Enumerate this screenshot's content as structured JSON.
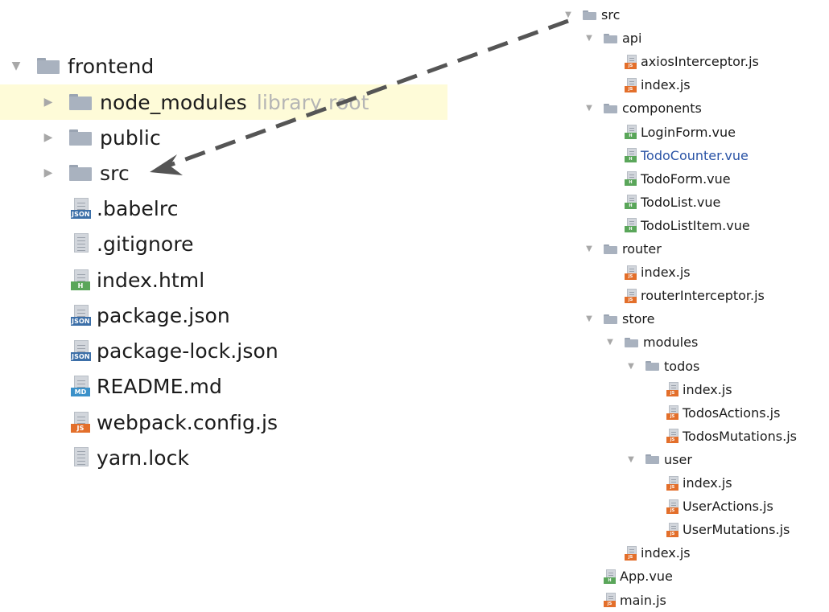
{
  "left_tree": {
    "root": {
      "label": "frontend",
      "expanded": true
    },
    "items": [
      {
        "kind": "folder",
        "label": "node_modules",
        "hint": "library root",
        "expanded": false,
        "highlighted": true
      },
      {
        "kind": "folder",
        "label": "public",
        "expanded": false
      },
      {
        "kind": "folder",
        "label": "src",
        "expanded": false
      },
      {
        "kind": "file",
        "label": ".babelrc",
        "icon": "json-file-icon",
        "tag": "JSON"
      },
      {
        "kind": "file",
        "label": ".gitignore",
        "icon": "text-file-icon",
        "tag": ""
      },
      {
        "kind": "file",
        "label": "index.html",
        "icon": "html-file-icon",
        "tag": "H"
      },
      {
        "kind": "file",
        "label": "package.json",
        "icon": "json-file-icon",
        "tag": "JSON"
      },
      {
        "kind": "file",
        "label": "package-lock.json",
        "icon": "json-file-icon",
        "tag": "JSON"
      },
      {
        "kind": "file",
        "label": "README.md",
        "icon": "markdown-file-icon",
        "tag": "MD"
      },
      {
        "kind": "file",
        "label": "webpack.config.js",
        "icon": "js-file-icon",
        "tag": "JS"
      },
      {
        "kind": "file",
        "label": "yarn.lock",
        "icon": "text-file-icon",
        "tag": ""
      }
    ]
  },
  "right_tree": {
    "items": [
      {
        "depth": 0,
        "kind": "folder",
        "label": "src",
        "expanded": true
      },
      {
        "depth": 1,
        "kind": "folder",
        "label": "api",
        "expanded": true
      },
      {
        "depth": 2,
        "kind": "file",
        "label": "axiosInterceptor.js",
        "tag": "JS"
      },
      {
        "depth": 2,
        "kind": "file",
        "label": "index.js",
        "tag": "JS"
      },
      {
        "depth": 1,
        "kind": "folder",
        "label": "components",
        "expanded": true
      },
      {
        "depth": 2,
        "kind": "file",
        "label": "LoginForm.vue",
        "tag": "H"
      },
      {
        "depth": 2,
        "kind": "file",
        "label": "TodoCounter.vue",
        "tag": "H",
        "modified": true
      },
      {
        "depth": 2,
        "kind": "file",
        "label": "TodoForm.vue",
        "tag": "H"
      },
      {
        "depth": 2,
        "kind": "file",
        "label": "TodoList.vue",
        "tag": "H"
      },
      {
        "depth": 2,
        "kind": "file",
        "label": "TodoListItem.vue",
        "tag": "H"
      },
      {
        "depth": 1,
        "kind": "folder",
        "label": "router",
        "expanded": true
      },
      {
        "depth": 2,
        "kind": "file",
        "label": "index.js",
        "tag": "JS"
      },
      {
        "depth": 2,
        "kind": "file",
        "label": "routerInterceptor.js",
        "tag": "JS"
      },
      {
        "depth": 1,
        "kind": "folder",
        "label": "store",
        "expanded": true
      },
      {
        "depth": 2,
        "kind": "folder",
        "label": "modules",
        "expanded": true
      },
      {
        "depth": 3,
        "kind": "folder",
        "label": "todos",
        "expanded": true
      },
      {
        "depth": 4,
        "kind": "file",
        "label": "index.js",
        "tag": "JS"
      },
      {
        "depth": 4,
        "kind": "file",
        "label": "TodosActions.js",
        "tag": "JS"
      },
      {
        "depth": 4,
        "kind": "file",
        "label": "TodosMutations.js",
        "tag": "JS"
      },
      {
        "depth": 3,
        "kind": "folder",
        "label": "user",
        "expanded": true
      },
      {
        "depth": 4,
        "kind": "file",
        "label": "index.js",
        "tag": "JS"
      },
      {
        "depth": 4,
        "kind": "file",
        "label": "UserActions.js",
        "tag": "JS"
      },
      {
        "depth": 4,
        "kind": "file",
        "label": "UserMutations.js",
        "tag": "JS"
      },
      {
        "depth": 2,
        "kind": "file",
        "label": "index.js",
        "tag": "JS"
      },
      {
        "depth": 1,
        "kind": "file",
        "label": "App.vue",
        "tag": "H"
      },
      {
        "depth": 1,
        "kind": "file",
        "label": "main.js",
        "tag": "JS"
      }
    ]
  },
  "colors": {
    "highlight_row": "#fefbd8",
    "modified_file": "#2b54a6",
    "hint_text": "#b5b5b5",
    "arrow": "#555555"
  }
}
